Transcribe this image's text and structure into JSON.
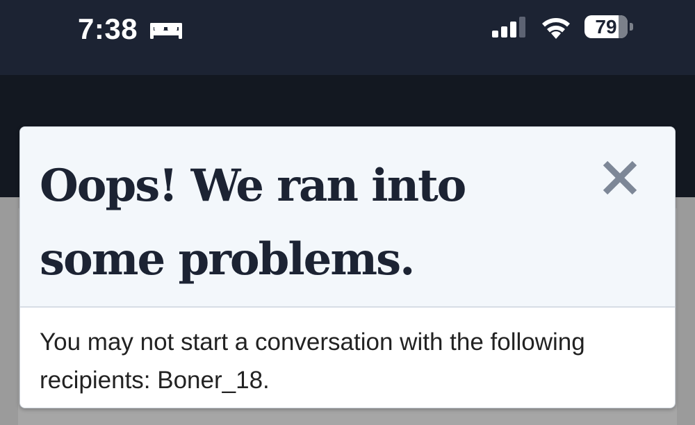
{
  "status_bar": {
    "time": "7:38",
    "focus_icon": "bed-icon",
    "signal_icon": "cellular-signal-icon",
    "wifi_icon": "wifi-icon",
    "battery_percent": "79",
    "battery_level": 0.79
  },
  "modal": {
    "title": "Oops! We ran into some problems.",
    "close_icon": "close-icon",
    "message": "You may not start a conversation with the following recipients: Boner_18."
  },
  "colors": {
    "status_bar_bg": "#1c2333",
    "header_bg": "#131821",
    "modal_header_bg": "#f3f7fb",
    "title_color": "#1c2333",
    "close_icon_color": "#7d8797",
    "overlay_bg": "#9b9b9b"
  }
}
